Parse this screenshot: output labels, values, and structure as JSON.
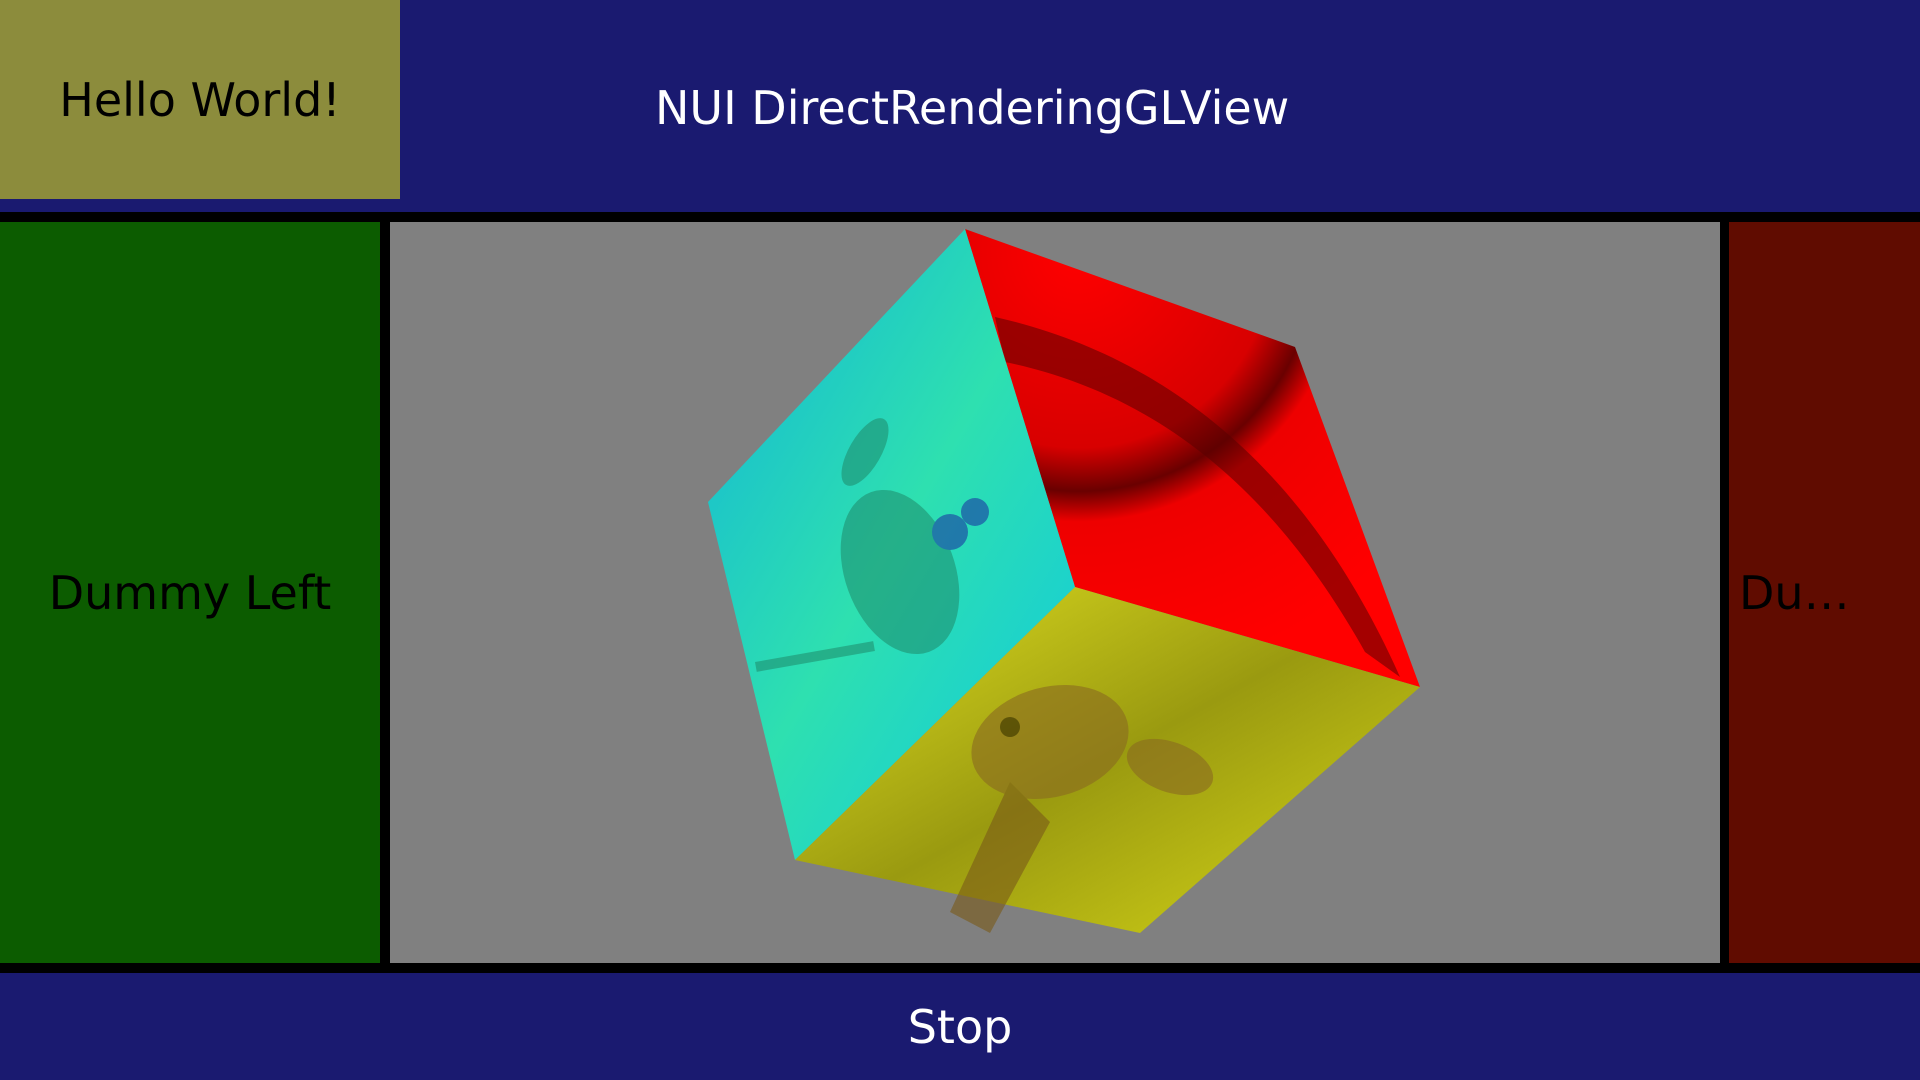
{
  "header": {
    "hello_label": "Hello World!",
    "title": "NUI DirectRenderingGLView"
  },
  "panels": {
    "left_label": "Dummy Left",
    "right_label": "Dummy Right"
  },
  "gl_view": {
    "background": "#808080",
    "faces": {
      "top_color": "#ff0000",
      "left_color": "#1ecfe8",
      "bottom_color": "#d8d820"
    }
  },
  "footer": {
    "stop_label": "Stop"
  },
  "colors": {
    "header_bg": "#1a1a70",
    "hello_bg": "#8c8c3c",
    "left_bg": "#0c5c00",
    "right_bg": "#600c00"
  }
}
